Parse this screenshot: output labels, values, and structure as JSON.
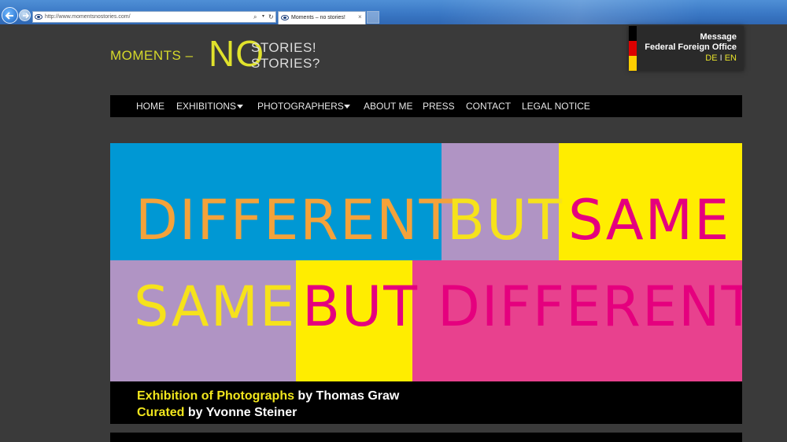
{
  "browser": {
    "url": "http://www.momentsnostories.com/",
    "tab_title": "Moments – no stories!",
    "tab_close": "×",
    "search_glyph": "⌕",
    "dropdown_glyph": "▾",
    "refresh_glyph": "↻"
  },
  "logo": {
    "moments": "MOMENTS –",
    "no": "NO",
    "stories_line1": "STORIES!",
    "stories_line2": "STORIES?"
  },
  "foreign_office": {
    "line1": "Message",
    "line2": "Federal Foreign Office",
    "lang_de": "DE",
    "lang_sep": "I",
    "lang_en": "EN",
    "flag_colors": [
      "#000000",
      "#dd0000",
      "#ffce00"
    ]
  },
  "nav": {
    "items": [
      {
        "label": "HOME",
        "dropdown": false
      },
      {
        "label": "EXHIBITIONS",
        "dropdown": true
      },
      {
        "label": "PHOTOGRAPHERS",
        "dropdown": true
      },
      {
        "label": "ABOUT ME",
        "dropdown": false
      },
      {
        "label": "PRESS",
        "dropdown": false
      },
      {
        "label": "CONTACT",
        "dropdown": false
      },
      {
        "label": "LEGAL NOTICE",
        "dropdown": false
      }
    ]
  },
  "banner": {
    "row1": {
      "word1": "DIFFERENT",
      "word2": "BUT",
      "word3": "SAME"
    },
    "row2": {
      "word1": "SAME",
      "word2": "BUT",
      "word3": "DIFFERENT"
    },
    "colors": {
      "blue": "#0098d4",
      "lilac": "#b094c4",
      "yellow": "#ffed00",
      "pink": "#e8418e",
      "orange": "#f4a23a",
      "magenta": "#e5007e",
      "text_yellow": "#f6e21b"
    },
    "caption": {
      "line1_highlight": "Exhibition of Photographs",
      "line1_rest": " by Thomas Graw",
      "line2_highlight": "Curated",
      "line2_rest": " by Yvonne Steiner"
    }
  }
}
